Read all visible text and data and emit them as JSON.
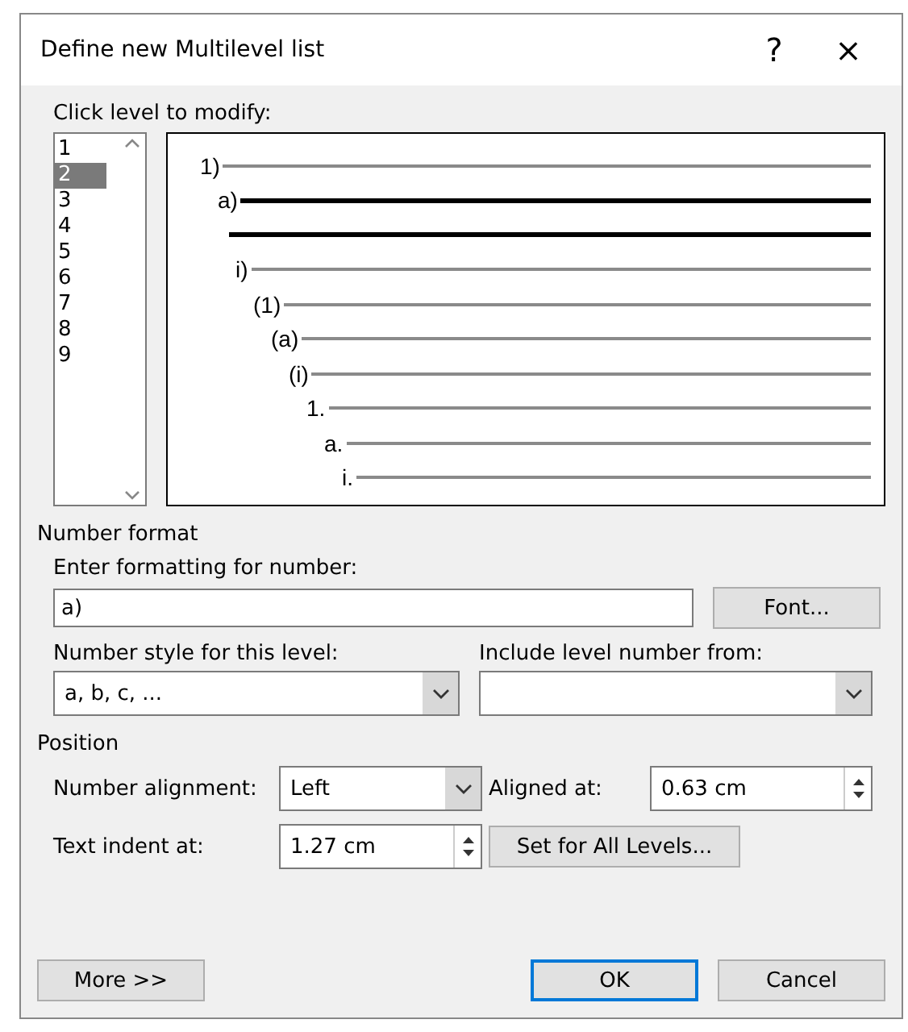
{
  "window": {
    "title": "Define new Multilevel list",
    "help": "?",
    "close": "×"
  },
  "levels_label": "Click level to modify:",
  "levels": [
    {
      "label": "1",
      "selected": false
    },
    {
      "label": "2",
      "selected": true
    },
    {
      "label": "3",
      "selected": false
    },
    {
      "label": "4",
      "selected": false
    },
    {
      "label": "5",
      "selected": false
    },
    {
      "label": "6",
      "selected": false
    },
    {
      "label": "7",
      "selected": false
    },
    {
      "label": "8",
      "selected": false
    },
    {
      "label": "9",
      "selected": false
    }
  ],
  "preview": [
    {
      "kind": "numbered",
      "label": "1)",
      "emphasized": false
    },
    {
      "kind": "numbered",
      "label": "a)",
      "emphasized": true
    },
    {
      "kind": "continuation",
      "emphasized": true
    },
    {
      "kind": "numbered",
      "label": "i)",
      "emphasized": false
    },
    {
      "kind": "numbered",
      "label": "(1)",
      "emphasized": false
    },
    {
      "kind": "numbered",
      "label": "(a)",
      "emphasized": false
    },
    {
      "kind": "numbered",
      "label": "(i)",
      "emphasized": false
    },
    {
      "kind": "numbered",
      "label": "1.",
      "emphasized": false
    },
    {
      "kind": "numbered",
      "label": "a.",
      "emphasized": false
    },
    {
      "kind": "numbered",
      "label": "i.",
      "emphasized": false
    }
  ],
  "number_format": {
    "heading": "Number format",
    "format_label": "Enter formatting for number:",
    "format_value": "a)",
    "font_button": "Font...",
    "style_label": "Number style for this level:",
    "style_value": "a, b, c, ...",
    "include_label": "Include level number from:"
  },
  "position": {
    "heading": "Position",
    "alignment_label": "Number alignment:",
    "alignment_value": "Left",
    "aligned_at_label": "Aligned at:",
    "aligned_at_value": "0.63 cm",
    "indent_label": "Text indent at:",
    "indent_value": "1.27 cm",
    "set_all_button": "Set for All Levels..."
  },
  "buttons": [
    {
      "label": "More >>",
      "kind": "secondary"
    },
    {
      "label": "OK",
      "kind": "default"
    },
    {
      "label": "Cancel",
      "kind": "secondary"
    }
  ]
}
